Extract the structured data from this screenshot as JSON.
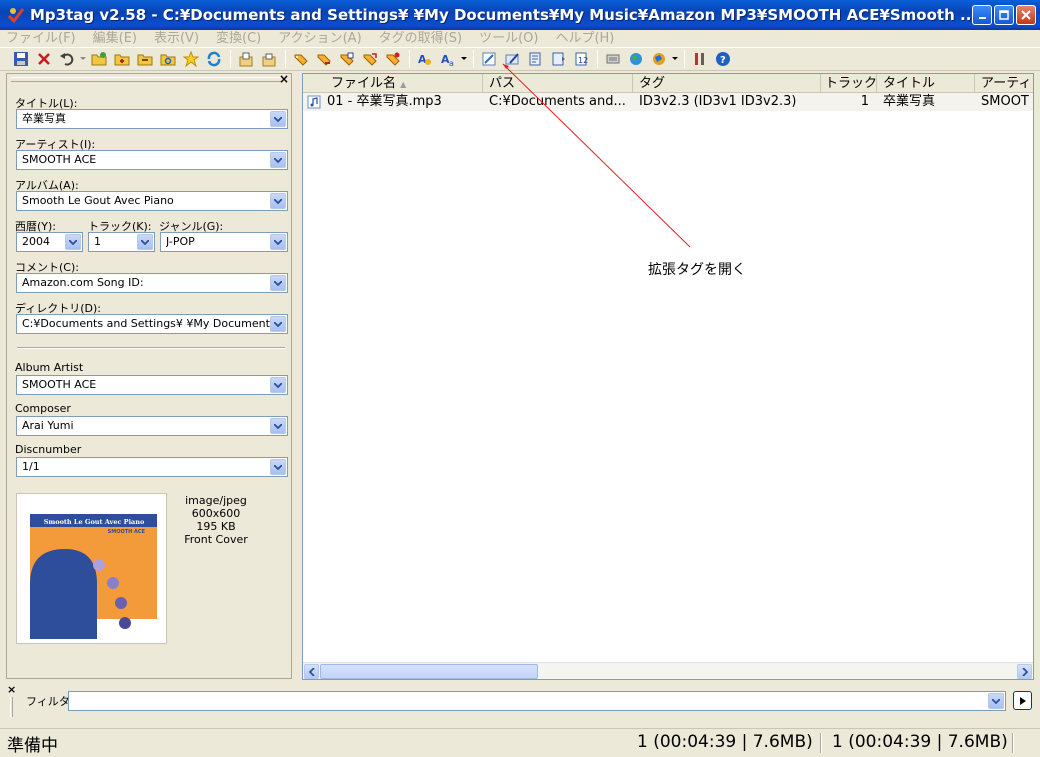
{
  "window": {
    "title": "Mp3tag v2.58 - C:¥Documents and Settings¥         ¥My Documents¥My Music¥Amazon MP3¥SMOOTH  ACE¥Smooth ..."
  },
  "menu": [
    "ファイル(F)",
    "編集(E)",
    "表示(V)",
    "変換(C)",
    "アクション(A)",
    "タグの取得(S)",
    "ツール(O)",
    "ヘルプ(H)"
  ],
  "toolbar_icons": [
    "save-icon",
    "remove-tag-icon",
    "undo-icon",
    "dropdown-arrow-icon",
    "change-dir-icon",
    "add-dir-icon",
    "open-dir-icon",
    "reload-dir-icon",
    "favorites-icon",
    "refresh-icon",
    "copy-tag-icon",
    "paste-tag-icon",
    "tag-filename-icon",
    "filename-tag-icon",
    "text-tag-icon",
    "tag-tag-icon",
    "autonumber-icon",
    "case-convert-icon",
    "actions-icon",
    "actions-dropdown-icon",
    "extended-tags-icon",
    "edit-icon",
    "export-icon",
    "playlist-icon",
    "number-icon",
    "freedb-icon",
    "web-source-icon",
    "web-dropdown-icon",
    "tools-icon",
    "help-icon"
  ],
  "panel": {
    "title_label": "タイトル(L):",
    "title_value": "卒業写真",
    "artist_label": "アーティスト(I):",
    "artist_value": "SMOOTH  ACE",
    "album_label": "アルバム(A):",
    "album_value": "Smooth Le Gout Avec Piano",
    "year_label": "西暦(Y):",
    "year_value": "2004",
    "track_label": "トラック(K):",
    "track_value": "1",
    "genre_label": "ジャンル(G):",
    "genre_value": "J-POP",
    "comment_label": "コメント(C):",
    "comment_value": "Amazon.com Song ID:",
    "directory_label": "ディレクトリ(D):",
    "directory_value": "C:¥Documents and Settings¥        ¥My Documents",
    "album_artist_label": "Album Artist",
    "album_artist_value": "SMOOTH  ACE",
    "composer_label": "Composer",
    "composer_value": "Arai Yumi",
    "discnumber_label": "Discnumber",
    "discnumber_value": "1/1",
    "cover": {
      "type": "image/jpeg",
      "dimensions": "600x600",
      "size": "195 KB",
      "kind": "Front Cover",
      "art_title": "Smooth Le Gout Avec Piano",
      "art_artist": "SMOOTH ACE"
    }
  },
  "columns": [
    "ファイル名",
    "パス",
    "タグ",
    "トラック",
    "タイトル",
    "アーティス"
  ],
  "rows": [
    {
      "filename": "01 - 卒業写真.mp3",
      "path": "C:¥Documents and...",
      "tag": "ID3v2.3 (ID3v1 ID3v2.3)",
      "track": "1",
      "title": "卒業写真",
      "artist": "SMOOT"
    }
  ],
  "annotation": "拡張タグを開く",
  "filter": {
    "label": "フィルタ:",
    "value": ""
  },
  "status": {
    "ready": "準備中",
    "selected": "1 (00:04:39 | 7.6MB)",
    "total": "1 (00:04:39 | 7.6MB)"
  },
  "colors": {
    "titlebar": "#0843b5",
    "selection_row": "#f4f3ee",
    "cover_orange": "#f39a3a",
    "cover_blue": "#2e4d9a"
  }
}
